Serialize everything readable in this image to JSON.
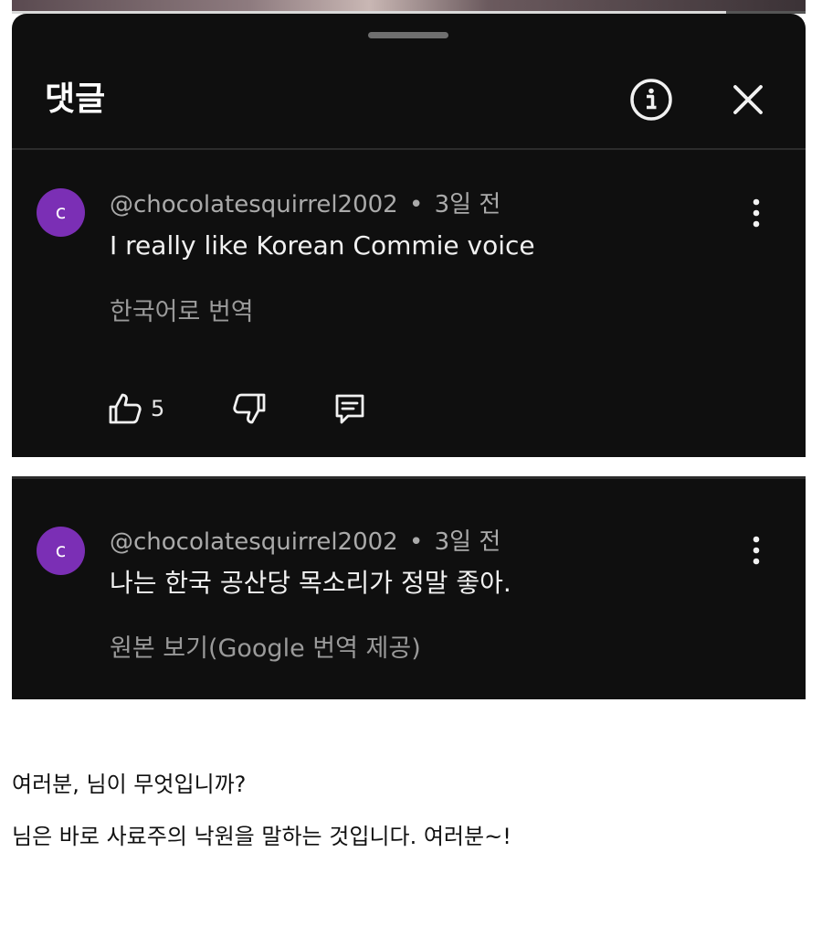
{
  "video": {
    "progress_fraction": 0.9
  },
  "panel": {
    "title": "댓글"
  },
  "comments": [
    {
      "avatar_letter": "c",
      "author": "@chocolatesquirrel2002",
      "separator": "•",
      "time": "3일 전",
      "text": "I really like Korean Commie voice",
      "translate_label": "한국어로 번역",
      "like_count": "5"
    },
    {
      "avatar_letter": "c",
      "author": "@chocolatesquirrel2002",
      "separator": "•",
      "time": "3일 전",
      "text": "나는 한국 공산당 목소리가 정말 좋아.",
      "translate_label": "원본 보기(Google 번역 제공)"
    }
  ],
  "article": {
    "line1": "여러분, 님이 무엇입니까?",
    "line2": "님은 바로 사료주의 낙원을 말하는 것입니다. 여러분~!"
  },
  "colors": {
    "panel_bg": "#0f0f0f",
    "avatar": "#7b2fb5",
    "page_bg": "#ffffff"
  },
  "icons": [
    "info-icon",
    "close-icon",
    "more-vert-icon",
    "thumbs-up-icon",
    "thumbs-down-icon",
    "reply-icon"
  ]
}
